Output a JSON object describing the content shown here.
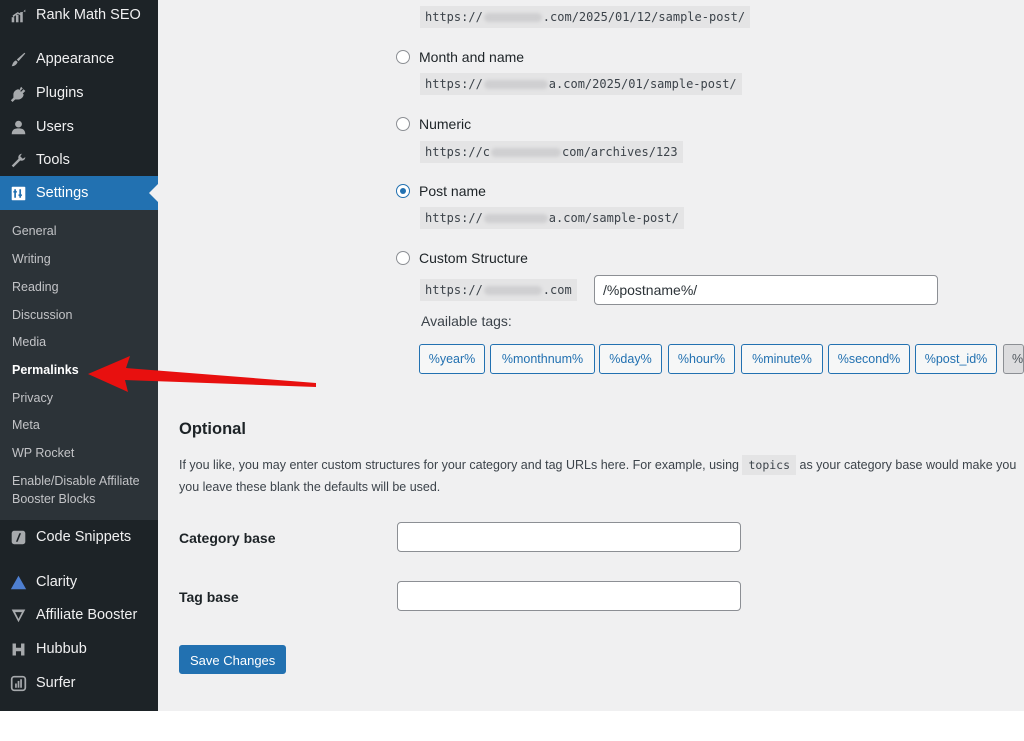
{
  "sidebar": {
    "items": [
      {
        "label": "Rank Math SEO",
        "icon": "rank-math-icon"
      },
      {
        "label": "Appearance",
        "icon": "paintbrush-icon"
      },
      {
        "label": "Plugins",
        "icon": "plugin-icon"
      },
      {
        "label": "Users",
        "icon": "users-icon"
      },
      {
        "label": "Tools",
        "icon": "wrench-icon"
      },
      {
        "label": "Settings",
        "icon": "settings-icon",
        "active": true
      },
      {
        "label": "Code Snippets",
        "icon": "code-snippets-icon"
      },
      {
        "label": "Clarity",
        "icon": "clarity-icon"
      },
      {
        "label": "Affiliate Booster",
        "icon": "affiliate-booster-icon"
      },
      {
        "label": "Hubbub",
        "icon": "hubbub-icon"
      },
      {
        "label": "Surfer",
        "icon": "surfer-icon"
      }
    ],
    "submenu": [
      "General",
      "Writing",
      "Reading",
      "Discussion",
      "Media",
      "Permalinks",
      "Privacy",
      "Meta",
      "WP Rocket",
      "Enable/Disable Affiliate",
      "Booster Blocks"
    ],
    "current_submenu": "Permalinks",
    "accent_color": "#2271b1"
  },
  "permalinks": {
    "options": [
      {
        "label": "Month and name",
        "url_prefix": "https://",
        "url_suffix": "a.com/2025/01/sample-post/",
        "checked": false
      },
      {
        "label": "Numeric",
        "url_prefix": "https://c",
        "url_suffix": "com/archives/123",
        "checked": false
      },
      {
        "label": "Post name",
        "url_prefix": "https://",
        "url_suffix": "a.com/sample-post/",
        "checked": true
      },
      {
        "label": "Custom Structure",
        "url_prefix": "https://",
        "url_suffix": ".com",
        "checked": false
      }
    ],
    "top_url_prefix": "https://",
    "top_url_suffix": ".com/2025/01/12/sample-post/",
    "custom_structure_value": "/%postname%/",
    "available_tags_label": "Available tags:",
    "tags": [
      "%year%",
      "%monthnum%",
      "%day%",
      "%hour%",
      "%minute%",
      "%second%",
      "%post_id%",
      "%"
    ]
  },
  "optional": {
    "heading": "Optional",
    "desc_line1_before": "If you like, you may enter custom structures for your category and tag URLs here. For example, using",
    "desc_code": "topics",
    "desc_line1_after": "as your category base would make you",
    "desc_line2": "you leave these blank the defaults will be used.",
    "category_base_label": "Category base",
    "category_base_value": "",
    "tag_base_label": "Tag base",
    "tag_base_value": ""
  },
  "save_button_label": "Save Changes",
  "annotation": {
    "arrow_color": "#e8100f"
  }
}
